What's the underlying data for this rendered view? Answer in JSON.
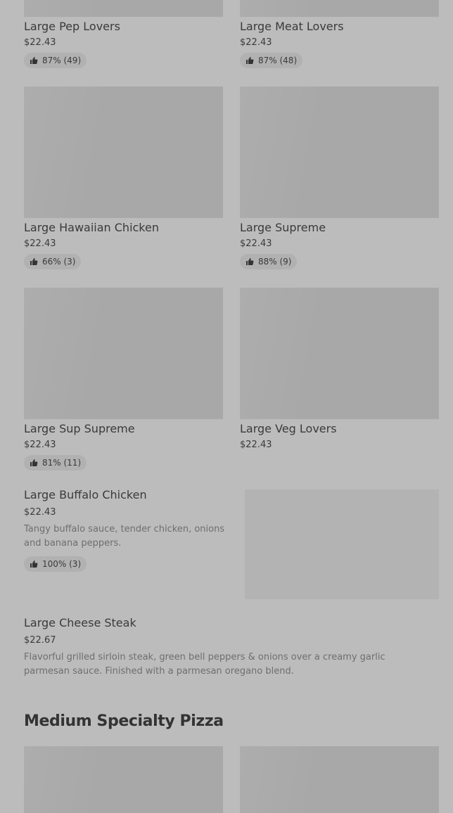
{
  "menu": {
    "row1": [
      {
        "name": "Large Pep Lovers",
        "price": "$22.43",
        "rating": "87% (49)"
      },
      {
        "name": "Large Meat Lovers",
        "price": "$22.43",
        "rating": "87% (48)"
      }
    ],
    "row2": [
      {
        "name": "Large Hawaiian Chicken",
        "price": "$22.43",
        "rating": "66% (3)"
      },
      {
        "name": "Large Supreme",
        "price": "$22.43",
        "rating": "88% (9)"
      }
    ],
    "row3": [
      {
        "name": "Large Sup Supreme",
        "price": "$22.43",
        "rating": "81% (11)"
      },
      {
        "name": "Large Veg Lovers",
        "price": "$22.43"
      }
    ],
    "buffalo": {
      "name": "Large Buffalo Chicken",
      "price": "$22.43",
      "description": "Tangy buffalo sauce, tender chicken, onions and banana peppers.",
      "rating": "100% (3)"
    },
    "cheese_steak": {
      "name": "Large Cheese Steak",
      "price": "$22.67",
      "description": "Flavorful grilled sirloin steak, green bell peppers & onions over a creamy garlic parmesan sauce. Finished with a parmesan oregano blend."
    },
    "section_title": "Medium Specialty Pizza"
  },
  "icons": {
    "rating": "thumbs-up-icon"
  },
  "colors": {
    "background": "#bcbcbc",
    "image_placeholder": "#a8a8a8",
    "badge": "#b1b1b1",
    "text": "#3a3a3a",
    "muted_text": "#6e6e6e"
  }
}
